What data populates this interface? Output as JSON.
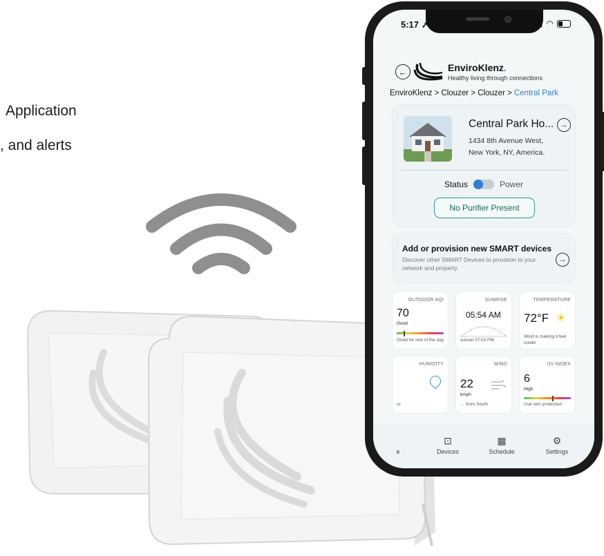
{
  "marketing": {
    "line1": "Application",
    "line2": ", and alerts"
  },
  "phone": {
    "status_time": "5:17",
    "app": {
      "brand": "EnviroKlenz",
      "brand_mark": ".",
      "tagline": "Healthy living through connections"
    },
    "breadcrumb": {
      "items": [
        "EnviroKlenz",
        "Clouzer",
        "Clouzer"
      ],
      "separator": " > ",
      "current": "Central Park"
    },
    "home_card": {
      "name": "Central Park Ho...",
      "address_line1": "1434 8th Avenue West,",
      "address_line2": "New York, NY, America.",
      "status_label": "Status",
      "power_label": "Power",
      "purifier_button": "No Purifier Present"
    },
    "add_card": {
      "title": "Add or provision new SMART devices",
      "description": "Discover other SMART Devices to provision to your network and property"
    },
    "tiles": {
      "aqi": {
        "label": "OUTDOOR AQI",
        "value": "70",
        "sub": "Good",
        "foot": "Good for rest of the day",
        "level": 0.14
      },
      "sunrise": {
        "label": "SUNRISE",
        "value": "05:54 AM",
        "foot": "sunset 07:53 PM"
      },
      "temperature": {
        "label": "TEMPERATURE",
        "value": "72°F",
        "foot_line1": "Wind is making it feel",
        "foot_line2": "cooler"
      },
      "humidity": {
        "label": "HUMIDITY",
        "foot": "ur"
      },
      "wind": {
        "label": "WIND",
        "value": "22",
        "unit": "kmph",
        "foot": "← from South"
      },
      "uv": {
        "label": "UV INDEX",
        "value": "6",
        "sub": "High",
        "foot": "Use skin protection",
        "level": 0.6
      }
    },
    "tabs": [
      {
        "label": "e",
        "icon": "home-icon"
      },
      {
        "label": "Devices",
        "icon": "devices-icon"
      },
      {
        "label": "Schedule",
        "icon": "calendar-icon"
      },
      {
        "label": "Settings",
        "icon": "gear-icon"
      }
    ]
  },
  "colors": {
    "accent_blue": "#2f7fd6",
    "button_green": "#2b9d8a",
    "background": "#f3f7f8"
  }
}
